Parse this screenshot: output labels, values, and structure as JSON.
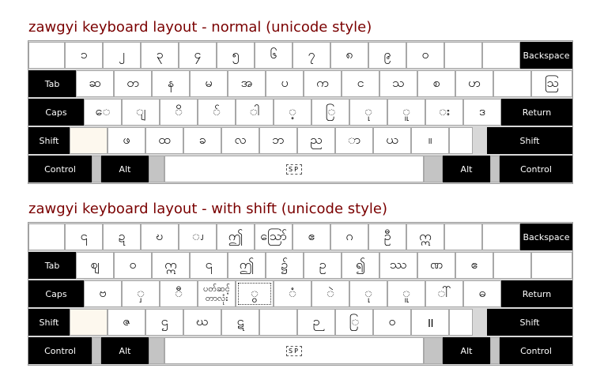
{
  "titles": {
    "normal": "zawgyi keyboard layout - normal (unicode style)",
    "shift": "zawgyi keyboard layout - with shift (unicode style)"
  },
  "labels": {
    "backspace": "Backspace",
    "tab": "Tab",
    "caps": "Caps",
    "return": "Return",
    "shift": "Shift",
    "control": "Control",
    "alt": "Alt",
    "space": "SP"
  },
  "normal": {
    "row1": [
      "",
      "၁",
      "၂",
      "၃",
      "၄",
      "၅",
      "၆",
      "၇",
      "၈",
      "၉",
      "၀",
      "",
      ""
    ],
    "row2": [
      "ဆ",
      "တ",
      "န",
      "မ",
      "အ",
      "ပ",
      "က",
      "င",
      "သ",
      "စ",
      "ဟ",
      "",
      "ဩ"
    ],
    "row3": [
      "ေ",
      "ျ",
      "ိ",
      "်",
      "ါ",
      "့",
      "ြ",
      "ု",
      "ူ",
      "း",
      "ဒ"
    ],
    "row4": [
      "",
      "ဖ",
      "ထ",
      "ခ",
      "လ",
      "ဘ",
      "ည",
      "ာ",
      "ယ",
      "။",
      ""
    ]
  },
  "shift": {
    "row1": [
      "",
      "၎",
      "ဍ",
      "ဎ",
      "ၪ",
      "ဤ",
      "ဪ",
      "ဧ",
      "ဂ",
      "ဦ",
      "ဣ",
      "",
      ""
    ],
    "row2": [
      "ဈ",
      "ဝ",
      "ဣ",
      "၎",
      "ဤ",
      "၌",
      "ဥ",
      "၍",
      "ဿ",
      "ဏ",
      "ဧ",
      "",
      ""
    ],
    "row3": [
      "ဗ",
      "ှ",
      "ီ",
      "ပတ်ဆင့် တာလုံး",
      "ွ",
      "ံ",
      "ဲ",
      "ု",
      "ူ",
      "ါ်",
      "ဓ"
    ],
    "row4": [
      "",
      "ဇ",
      "ဌ",
      "ဃ",
      "ဋ",
      "",
      "ဉ",
      "ြ",
      "ဝ",
      "॥",
      ""
    ]
  }
}
